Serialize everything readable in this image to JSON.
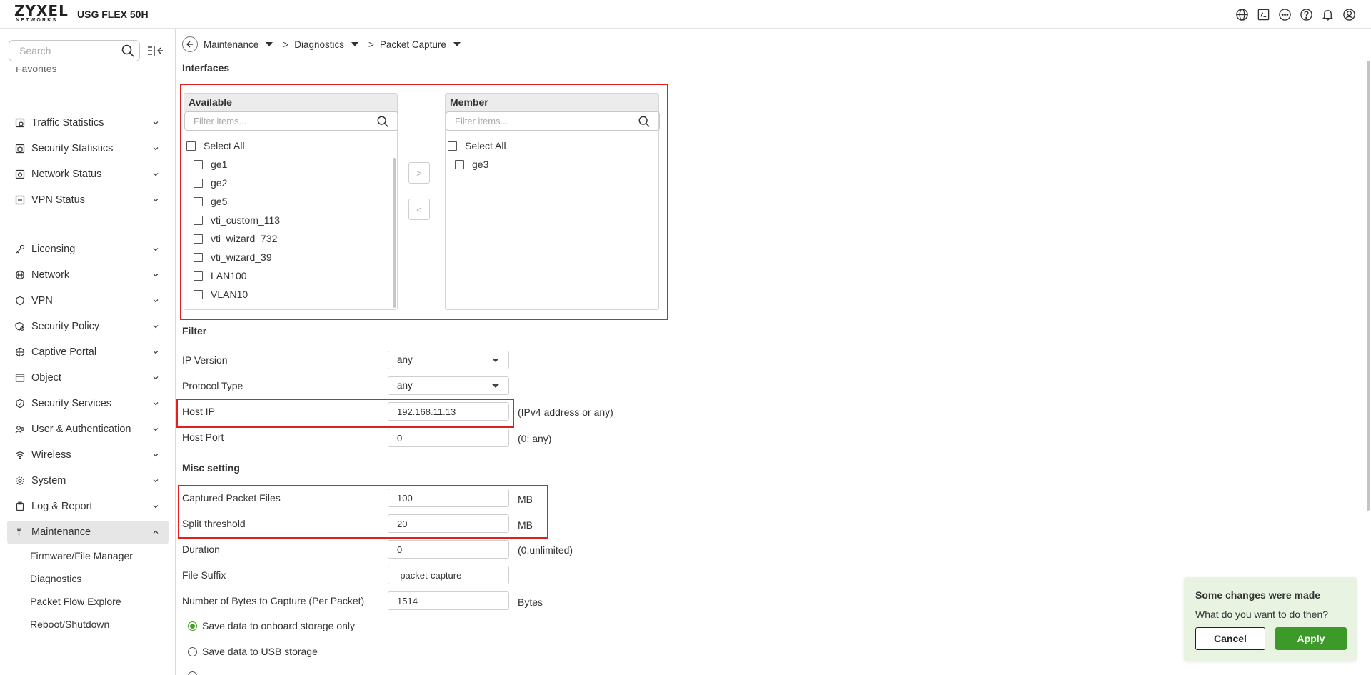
{
  "header": {
    "brand": "ZYXEL",
    "brand_sub": "NETWORKS",
    "model": "USG FLEX 50H",
    "icons": [
      "globe-icon",
      "cli-icon",
      "more-icon",
      "help-icon",
      "bell-icon",
      "user-icon"
    ]
  },
  "sidebar": {
    "search_placeholder": "Search",
    "favorites_label": "Favorites",
    "items": [
      {
        "label": "Traffic Statistics",
        "icon": "chart-icon"
      },
      {
        "label": "Security Statistics",
        "icon": "shield-chart-icon"
      },
      {
        "label": "Network Status",
        "icon": "network-status-icon"
      },
      {
        "label": "VPN Status",
        "icon": "vpn-status-icon"
      },
      {
        "label": "Licensing",
        "icon": "key-icon"
      },
      {
        "label": "Network",
        "icon": "globe-icon"
      },
      {
        "label": "VPN",
        "icon": "shield-icon"
      },
      {
        "label": "Security Policy",
        "icon": "policy-icon"
      },
      {
        "label": "Captive Portal",
        "icon": "portal-icon"
      },
      {
        "label": "Object",
        "icon": "object-icon"
      },
      {
        "label": "Security Services",
        "icon": "security-services-icon"
      },
      {
        "label": "User & Authentication",
        "icon": "users-icon"
      },
      {
        "label": "Wireless",
        "icon": "wifi-icon"
      },
      {
        "label": "System",
        "icon": "gear-icon"
      },
      {
        "label": "Log & Report",
        "icon": "clipboard-icon"
      },
      {
        "label": "Maintenance",
        "icon": "wrench-icon"
      }
    ],
    "maintenance_sub": [
      "Firmware/File Manager",
      "Diagnostics",
      "Packet Flow Explore",
      "Reboot/Shutdown"
    ]
  },
  "breadcrumb": [
    "Maintenance",
    "Diagnostics",
    "Packet Capture"
  ],
  "breadcrumb_sep": ">",
  "interfaces": {
    "title": "Interfaces",
    "available": {
      "title": "Available",
      "filter_placeholder": "Filter items...",
      "select_all": "Select All",
      "items": [
        "ge1",
        "ge2",
        "ge5",
        "vti_custom_113",
        "vti_wizard_732",
        "vti_wizard_39",
        "LAN100",
        "VLAN10"
      ]
    },
    "member": {
      "title": "Member",
      "filter_placeholder": "Filter items...",
      "select_all": "Select All",
      "items": [
        "ge3"
      ]
    },
    "move_right": ">",
    "move_left": "<"
  },
  "filter": {
    "title": "Filter",
    "ip_version_label": "IP Version",
    "ip_version_value": "any",
    "protocol_label": "Protocol Type",
    "protocol_value": "any",
    "host_ip_label": "Host IP",
    "host_ip_value": "192.168.11.13",
    "host_ip_hint": "(IPv4 address or any)",
    "host_port_label": "Host Port",
    "host_port_value": "0",
    "host_port_hint": "(0: any)"
  },
  "misc": {
    "title": "Misc setting",
    "captured_files_label": "Captured Packet Files",
    "captured_files_value": "100",
    "captured_files_unit": "MB",
    "split_label": "Split threshold",
    "split_value": "20",
    "split_unit": "MB",
    "duration_label": "Duration",
    "duration_value": "0",
    "duration_hint": "(0:unlimited)",
    "suffix_label": "File Suffix",
    "suffix_value": "-packet-capture",
    "bytes_label": "Number of Bytes to Capture (Per Packet)",
    "bytes_value": "1514",
    "bytes_unit": "Bytes",
    "radio_onboard": "Save data to onboard storage only",
    "radio_usb": "Save data to USB storage"
  },
  "toast": {
    "title": "Some changes were made",
    "message": "What do you want to do then?",
    "cancel": "Cancel",
    "apply": "Apply"
  },
  "colors": {
    "highlight_red": "#e02020",
    "apply_green": "#3d9a2a",
    "toast_bg": "#e8f3e1",
    "active_nav_bg": "#e6e6e6"
  }
}
